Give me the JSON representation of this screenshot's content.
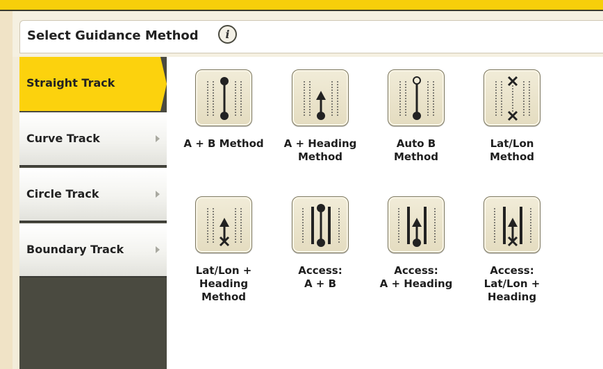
{
  "header": {
    "title": "Select Guidance Method",
    "info_icon": "info-icon"
  },
  "sidebar": {
    "items": [
      {
        "label": "Straight Track",
        "selected": true
      },
      {
        "label": "Curve Track",
        "selected": false
      },
      {
        "label": "Circle Track",
        "selected": false
      },
      {
        "label": "Boundary Track",
        "selected": false
      }
    ]
  },
  "methods": [
    {
      "label": "A + B Method",
      "icon": "ab-line-icon"
    },
    {
      "label": "A + Heading\nMethod",
      "icon": "a-heading-icon"
    },
    {
      "label": "Auto B\nMethod",
      "icon": "auto-b-icon"
    },
    {
      "label": "Lat/Lon\nMethod",
      "icon": "lat-lon-icon"
    },
    {
      "label": "Lat/Lon +\nHeading\nMethod",
      "icon": "lat-lon-heading-icon"
    },
    {
      "label": "Access:\nA + B",
      "icon": "access-ab-icon"
    },
    {
      "label": "Access:\nA + Heading",
      "icon": "access-a-heading-icon"
    },
    {
      "label": "Access:\nLat/Lon +\nHeading",
      "icon": "access-lat-lon-heading-icon"
    }
  ],
  "colors": {
    "selected": "#fcd20d",
    "sidebar_dark": "#4a4a40",
    "top_bar": "#f7cf0a"
  }
}
